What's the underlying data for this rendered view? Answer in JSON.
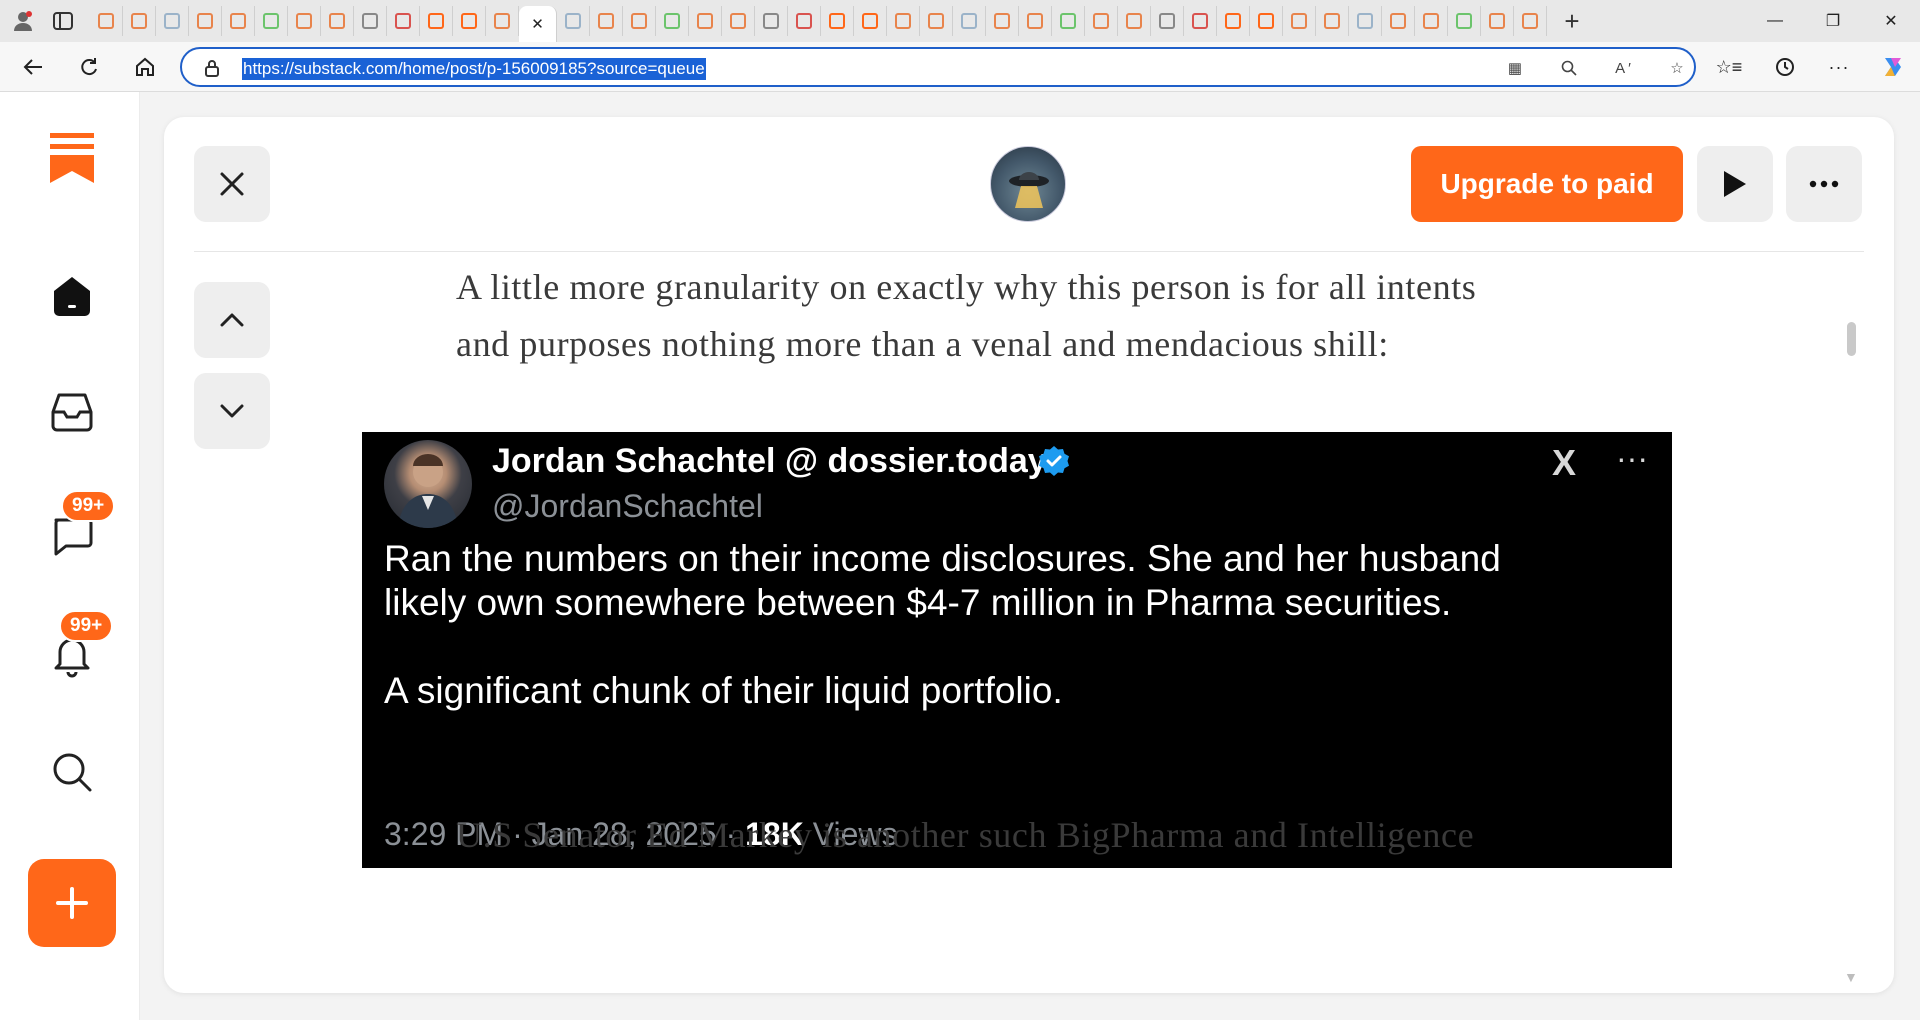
{
  "browser": {
    "url": "https://substack.com/home/post/p-156009185?source=queue",
    "tab_count": 44,
    "active_tab_index": 13
  },
  "rail": {
    "chat_badge": "99+",
    "activity_badge": "99+"
  },
  "reader": {
    "upgrade_label": "Upgrade to paid",
    "paragraph_1_line_1": "A little more granularity on exactly why this person is for all intents",
    "paragraph_1_line_2": "and purposes nothing more than a venal and mendacious shill:",
    "paragraph_2_line_1": "U.S Senator Ed Markey is another such BigPharma and Intelligence"
  },
  "tweet": {
    "name": "Jordan Schachtel @ dossier.today",
    "handle": "@JordanSchachtel",
    "line_1": "Ran the numbers on their income disclosures. She and her husband",
    "line_2": "likely own somewhere between $4-7 million in Pharma securities.",
    "line_3": "A significant chunk of their liquid portfolio.",
    "time_date": "3:29 PM · Jan 28, 2025 · ",
    "views_count": "18K",
    "views_label": " Views",
    "x_logo": "X"
  },
  "colors": {
    "brand_orange": "#ff6719",
    "address_focus": "#1f5fc9"
  }
}
